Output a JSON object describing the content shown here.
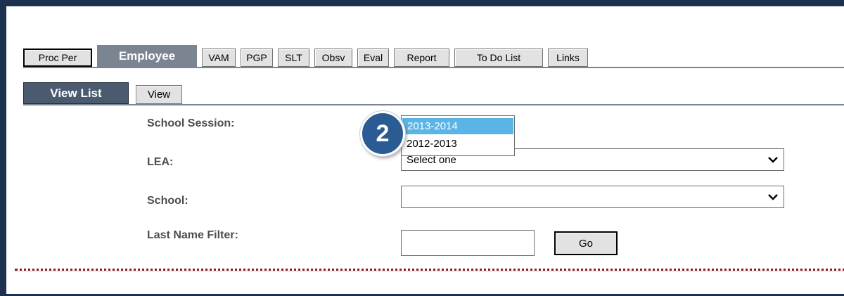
{
  "tabs": [
    {
      "label": "Proc Per"
    },
    {
      "label": "Employee",
      "active": true
    },
    {
      "label": "VAM"
    },
    {
      "label": "PGP"
    },
    {
      "label": "SLT"
    },
    {
      "label": "Obsv"
    },
    {
      "label": "Eval"
    },
    {
      "label": "Report"
    },
    {
      "label": "To Do List"
    },
    {
      "label": "Links"
    }
  ],
  "subtabs": [
    {
      "label": "View List",
      "active": true
    },
    {
      "label": "View"
    }
  ],
  "form": {
    "school_session": {
      "label": "School Session:",
      "options": [
        "2013-2014",
        "2012-2013"
      ],
      "selected": "2013-2014"
    },
    "lea": {
      "label": "LEA:",
      "value": "Select one"
    },
    "school": {
      "label": "School:",
      "value": ""
    },
    "last_name_filter": {
      "label": "Last Name Filter:",
      "value": ""
    },
    "go_label": "Go"
  },
  "callout": {
    "number": "2"
  },
  "colors": {
    "frame": "#1d3250",
    "active_tab": "#7b8592",
    "active_subtab": "#4a5b70",
    "highlight": "#5ab4e5",
    "badge": "#2a5c93",
    "divider_dots": "#8a1c1c"
  }
}
